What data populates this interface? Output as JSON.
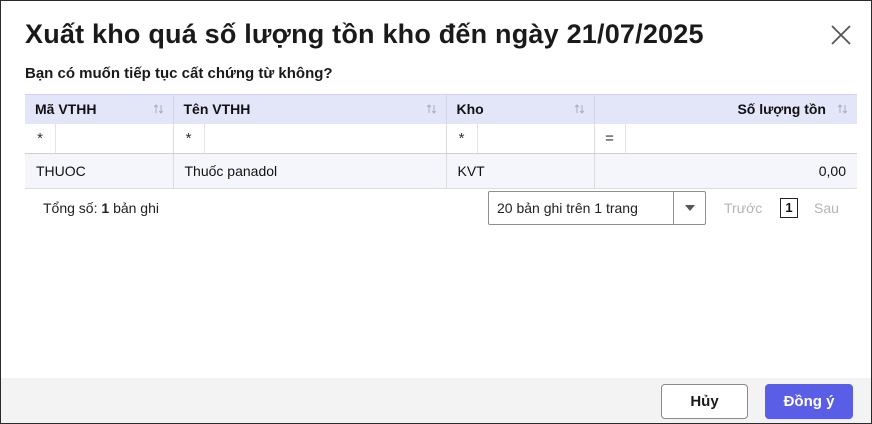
{
  "dialog": {
    "title": "Xuất kho quá số lượng tồn kho đến ngày 21/07/2025",
    "question": "Bạn có muốn tiếp tục cất chứng từ không?"
  },
  "table": {
    "columns": [
      "Mã VTHH",
      "Tên VTHH",
      "Kho",
      "Số lượng tồn"
    ],
    "filter_ops": [
      "*",
      "*",
      "*",
      "="
    ],
    "rows": [
      [
        "THUOC",
        "Thuốc panadol",
        "KVT",
        "0,00"
      ]
    ]
  },
  "footer_info": {
    "total_prefix": "Tổng số:",
    "total_count": "1",
    "total_suffix": "bản ghi"
  },
  "pagination": {
    "page_size_label": "20 bản ghi trên 1 trang",
    "prev_label": "Trước",
    "current_page": "1",
    "next_label": "Sau"
  },
  "buttons": {
    "cancel": "Hủy",
    "ok": "Đồng ý"
  },
  "colors": {
    "accent": "#5a5ee6",
    "header_bg": "#e3e5f8",
    "row_bg": "#f5f6fc"
  },
  "icons": {
    "close": "close-icon",
    "sort": "sort-icon",
    "dropdown": "chevron-down-icon"
  }
}
